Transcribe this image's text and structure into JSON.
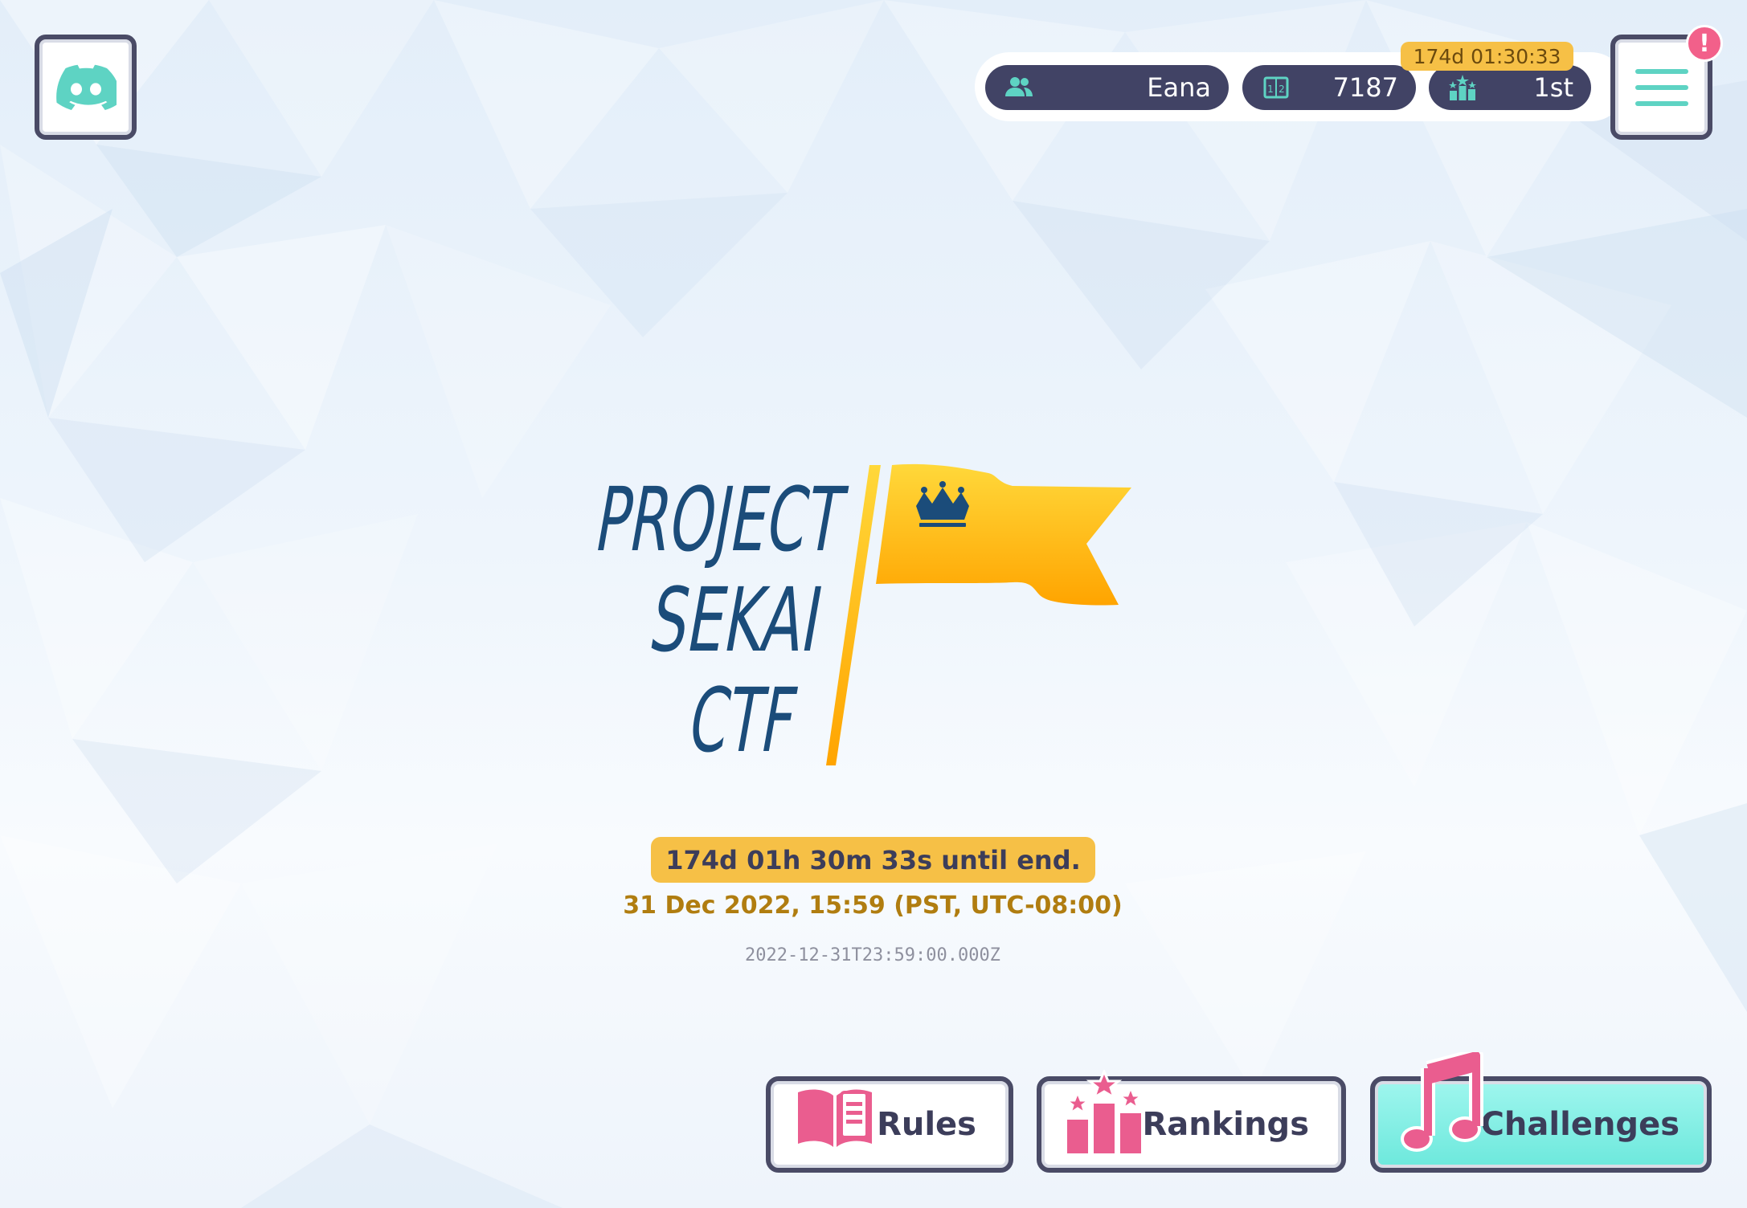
{
  "header": {
    "team_name": "Eana",
    "score": "7187",
    "rank": "1st",
    "timer_chip": "174d 01:30:33",
    "notification_badge": "!"
  },
  "logo": {
    "line1": "PROJECT",
    "line2": "SEKAI",
    "line3": "CTF"
  },
  "countdown": {
    "remaining": "174d 01h 30m 33s until end.",
    "end_local": "31 Dec 2022, 15:59 (PST, UTC-08:00)",
    "end_iso": "2022-12-31T23:59:00.000Z"
  },
  "nav": {
    "rules": "Rules",
    "rankings": "Rankings",
    "challenges": "Challenges"
  },
  "colors": {
    "accent_teal": "#5ed3c3",
    "accent_pink": "#f2608a",
    "accent_gold": "#f6c046",
    "dark_navy": "#414365"
  },
  "icons": {
    "discord": "discord-icon",
    "menu": "hamburger-menu-icon",
    "team": "team-users-icon",
    "score": "scoreboard-icon",
    "rank": "podium-stars-icon",
    "rules": "open-book-icon",
    "rankings": "podium-icon",
    "challenges": "music-note-icon"
  }
}
